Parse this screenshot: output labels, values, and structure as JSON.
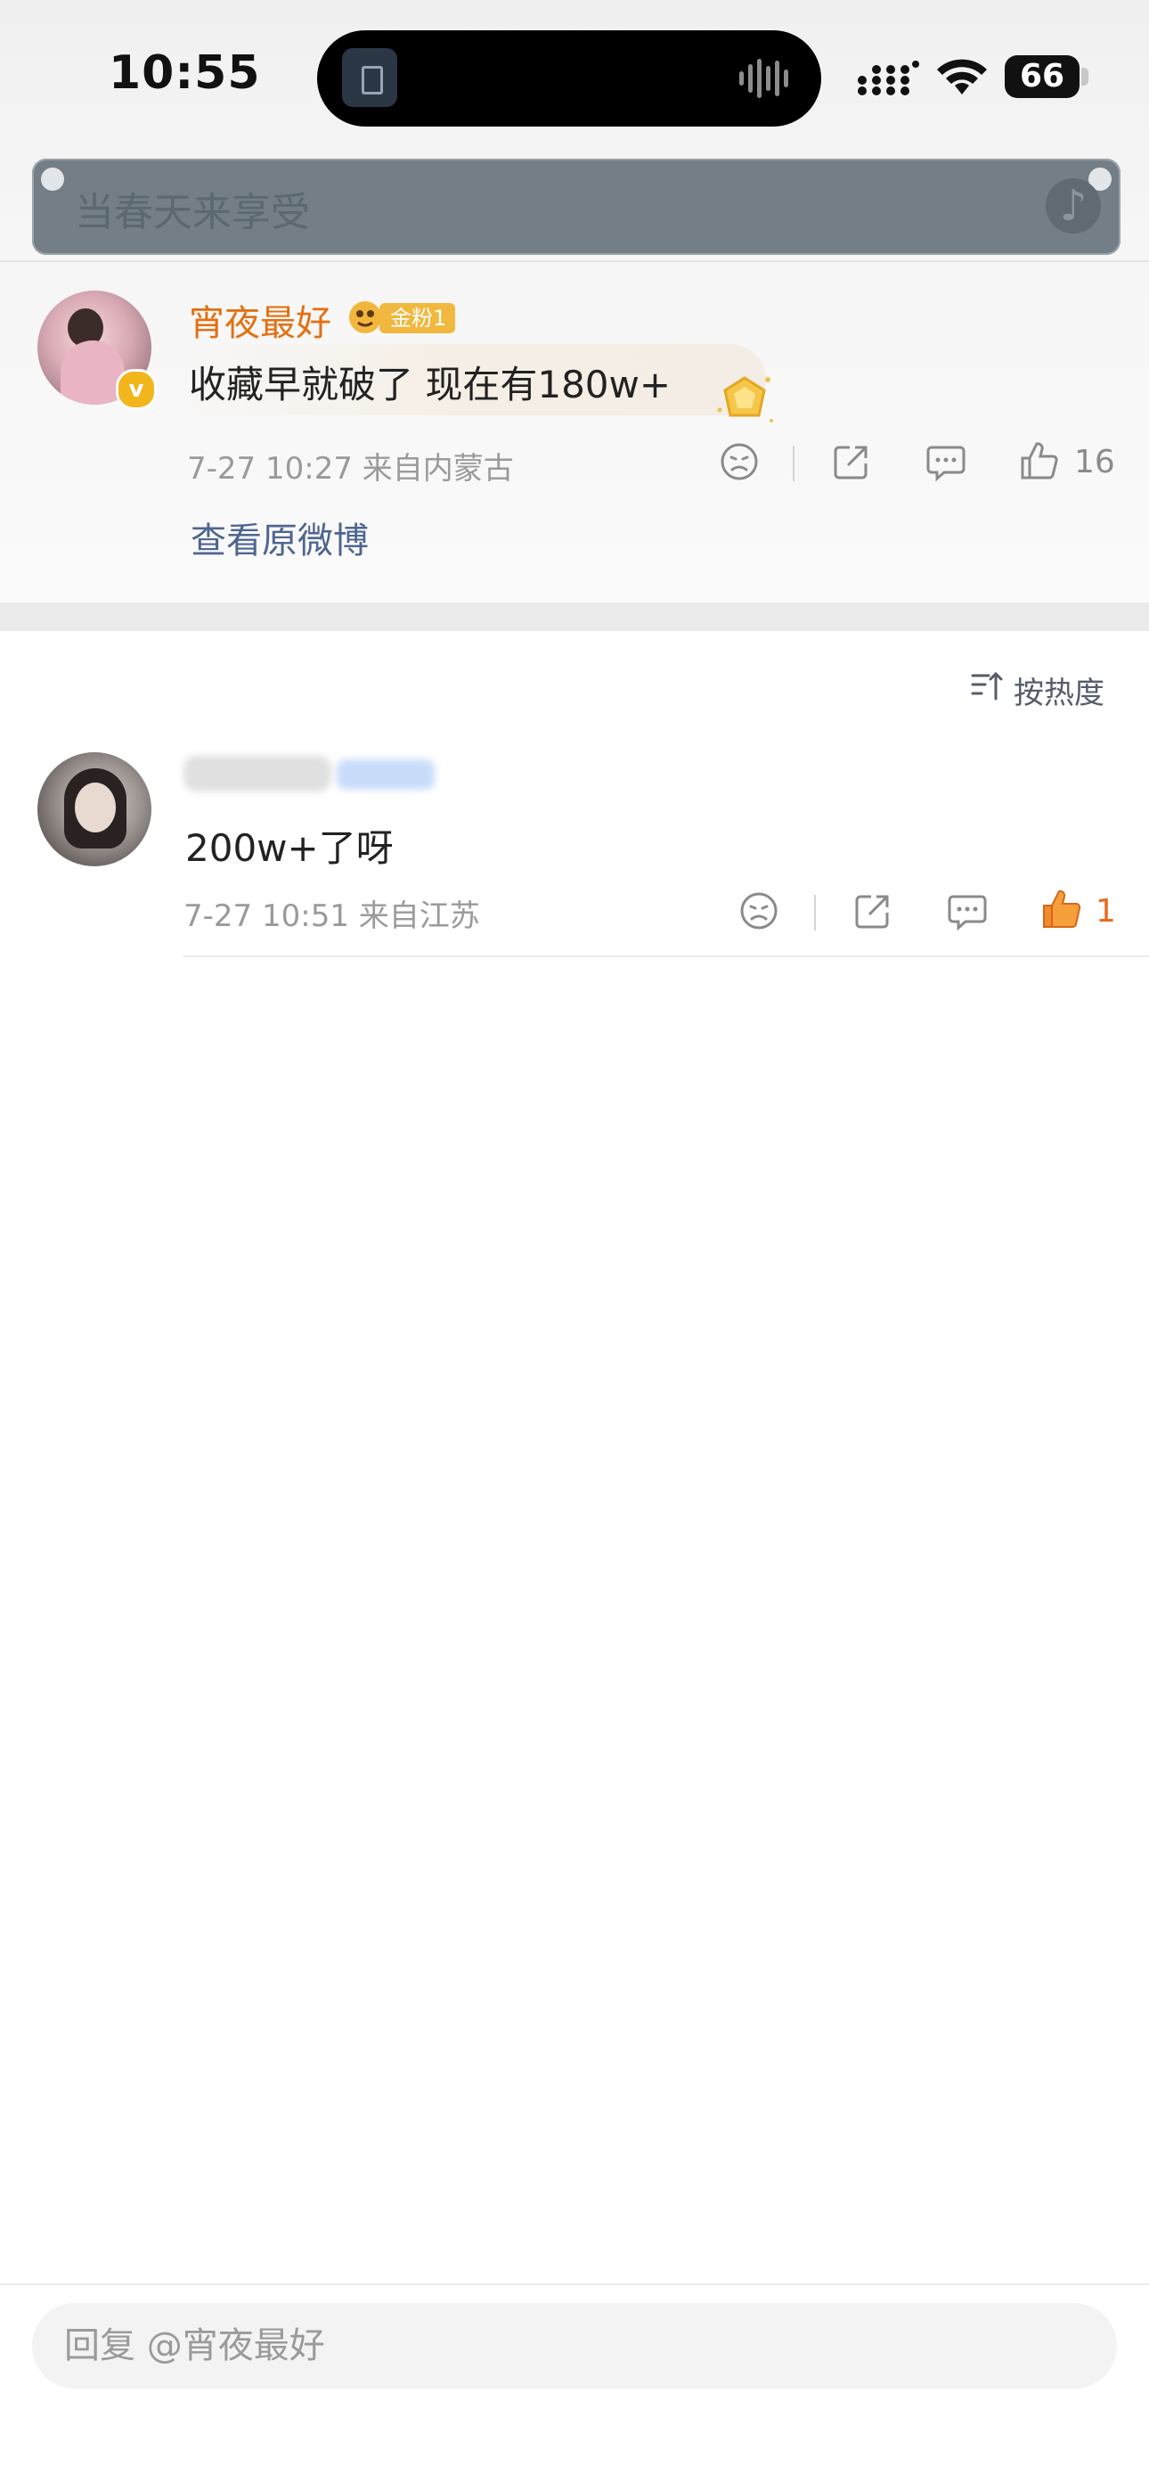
{
  "status_bar": {
    "time": "10:55",
    "battery": "66"
  },
  "search": {
    "placeholder": "当春天来享受"
  },
  "main_comment": {
    "username": "宵夜最好",
    "fan_badge": "金粉1",
    "text": "收藏早就破了 现在有180w+",
    "meta": "7-27 10:27  来自内蒙古",
    "like_count": "16",
    "view_original": "查看原微博"
  },
  "sort": {
    "label": "按热度"
  },
  "reply": {
    "text": "200w+了呀",
    "meta": "7-27 10:51  来自江苏",
    "like_count": "1"
  },
  "bottom_bar": {
    "placeholder": "回复 @宵夜最好"
  },
  "colors": {
    "username": "#e37012",
    "link": "#4e6591",
    "liked": "#e86b1f",
    "badge": "#f0b83e"
  },
  "icons": [
    "signal-icon",
    "wifi-icon",
    "battery-icon",
    "sad-icon",
    "share-icon",
    "comment-icon",
    "like-icon",
    "sort-icon",
    "medal-icon",
    "fan-icon"
  ]
}
